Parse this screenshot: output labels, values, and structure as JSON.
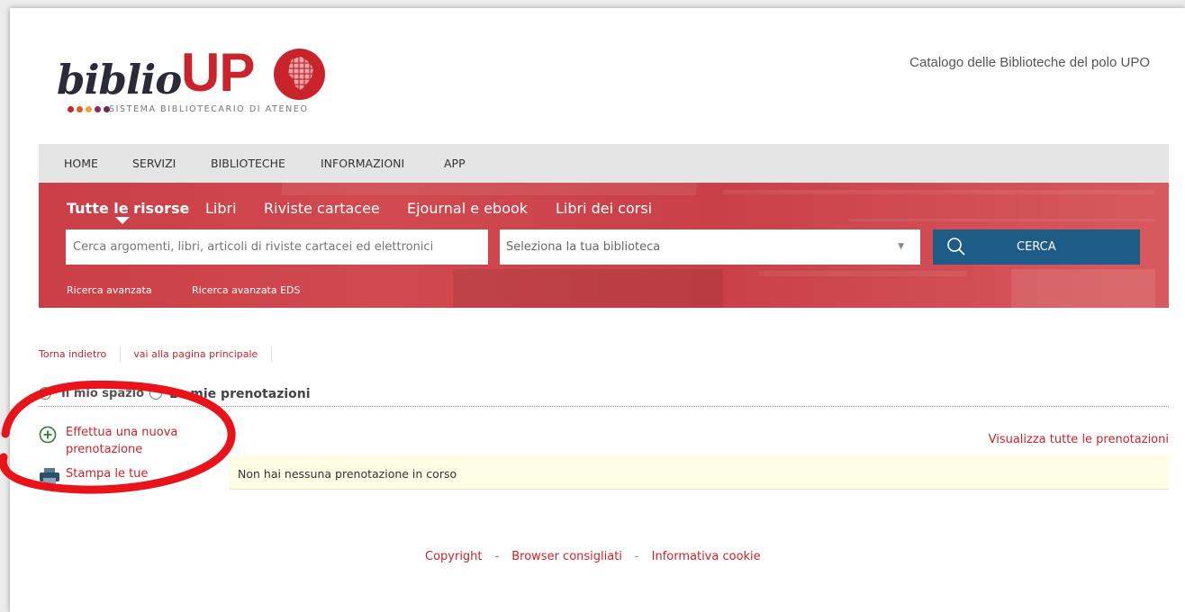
{
  "header": {
    "logo": {
      "word": "biblio",
      "upo": "UP",
      "tagline": "SISTEMA BIBLIOTECARIO DI ATENEO",
      "dot_colors": [
        "#c9242b",
        "#e25a2a",
        "#f0a53a",
        "#8b2a55",
        "#6a2e4f"
      ]
    },
    "catalog_title": "Catalogo delle Biblioteche del polo UPO"
  },
  "nav": {
    "items": [
      "HOME",
      "SERVIZI",
      "BIBLIOTECHE",
      "INFORMAZIONI",
      "APP"
    ]
  },
  "search": {
    "tabs": [
      "Tutte le risorse",
      "Libri",
      "Riviste cartacee",
      "Ejournal e ebook",
      "Libri dei corsi"
    ],
    "active_tab": "Tutte le risorse",
    "input_placeholder": "Cerca argomenti, libri, articoli di riviste cartacei ed elettronici",
    "library_select": "Seleziona la tua biblioteca",
    "button_label": "CERCA",
    "advanced": [
      "Ricerca avanzata",
      "Ricerca avanzata EDS"
    ]
  },
  "breadcrumbs": {
    "back": "Torna indietro",
    "home": "vai alla pagina principale"
  },
  "section": {
    "my_space": "Il mio spazio",
    "title": "Le mie prenotazioni"
  },
  "sidebar": {
    "new_booking": "Effettua una nuova prenotazione",
    "print": "Stampa le tue prenotazioni"
  },
  "content": {
    "view_all": "Visualizza tutte le prenotazioni",
    "notice": "Non hai nessuna prenotazione in corso"
  },
  "footer": {
    "links": [
      "Copyright",
      "Browser consigliati",
      "Informativa cookie"
    ]
  },
  "colors": {
    "brand_red": "#c9242b",
    "search_button": "#1e5b86",
    "annotation_ring": "#e8141a"
  }
}
